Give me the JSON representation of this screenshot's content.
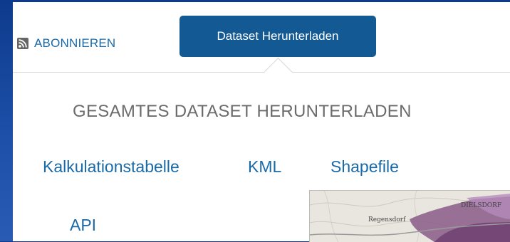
{
  "header": {
    "subscribe_label": "ABONNIEREN",
    "download_button_label": "Dataset Herunterladen"
  },
  "download_panel": {
    "title": "GESAMTES DATASET HERUNTERLADEN",
    "formats": [
      "Kalkulationstabelle",
      "KML",
      "Shapefile",
      "API"
    ]
  },
  "map_preview": {
    "labels": [
      "Regensdorf",
      "DIELSDORF"
    ]
  },
  "colors": {
    "link": "#1a6aa8",
    "button": "#135a94",
    "title_text": "#6b6b6b",
    "background": "#1d4fa8"
  },
  "icons": {
    "subscribe": "rss-icon",
    "panel_pointer": "caret-up-icon"
  }
}
